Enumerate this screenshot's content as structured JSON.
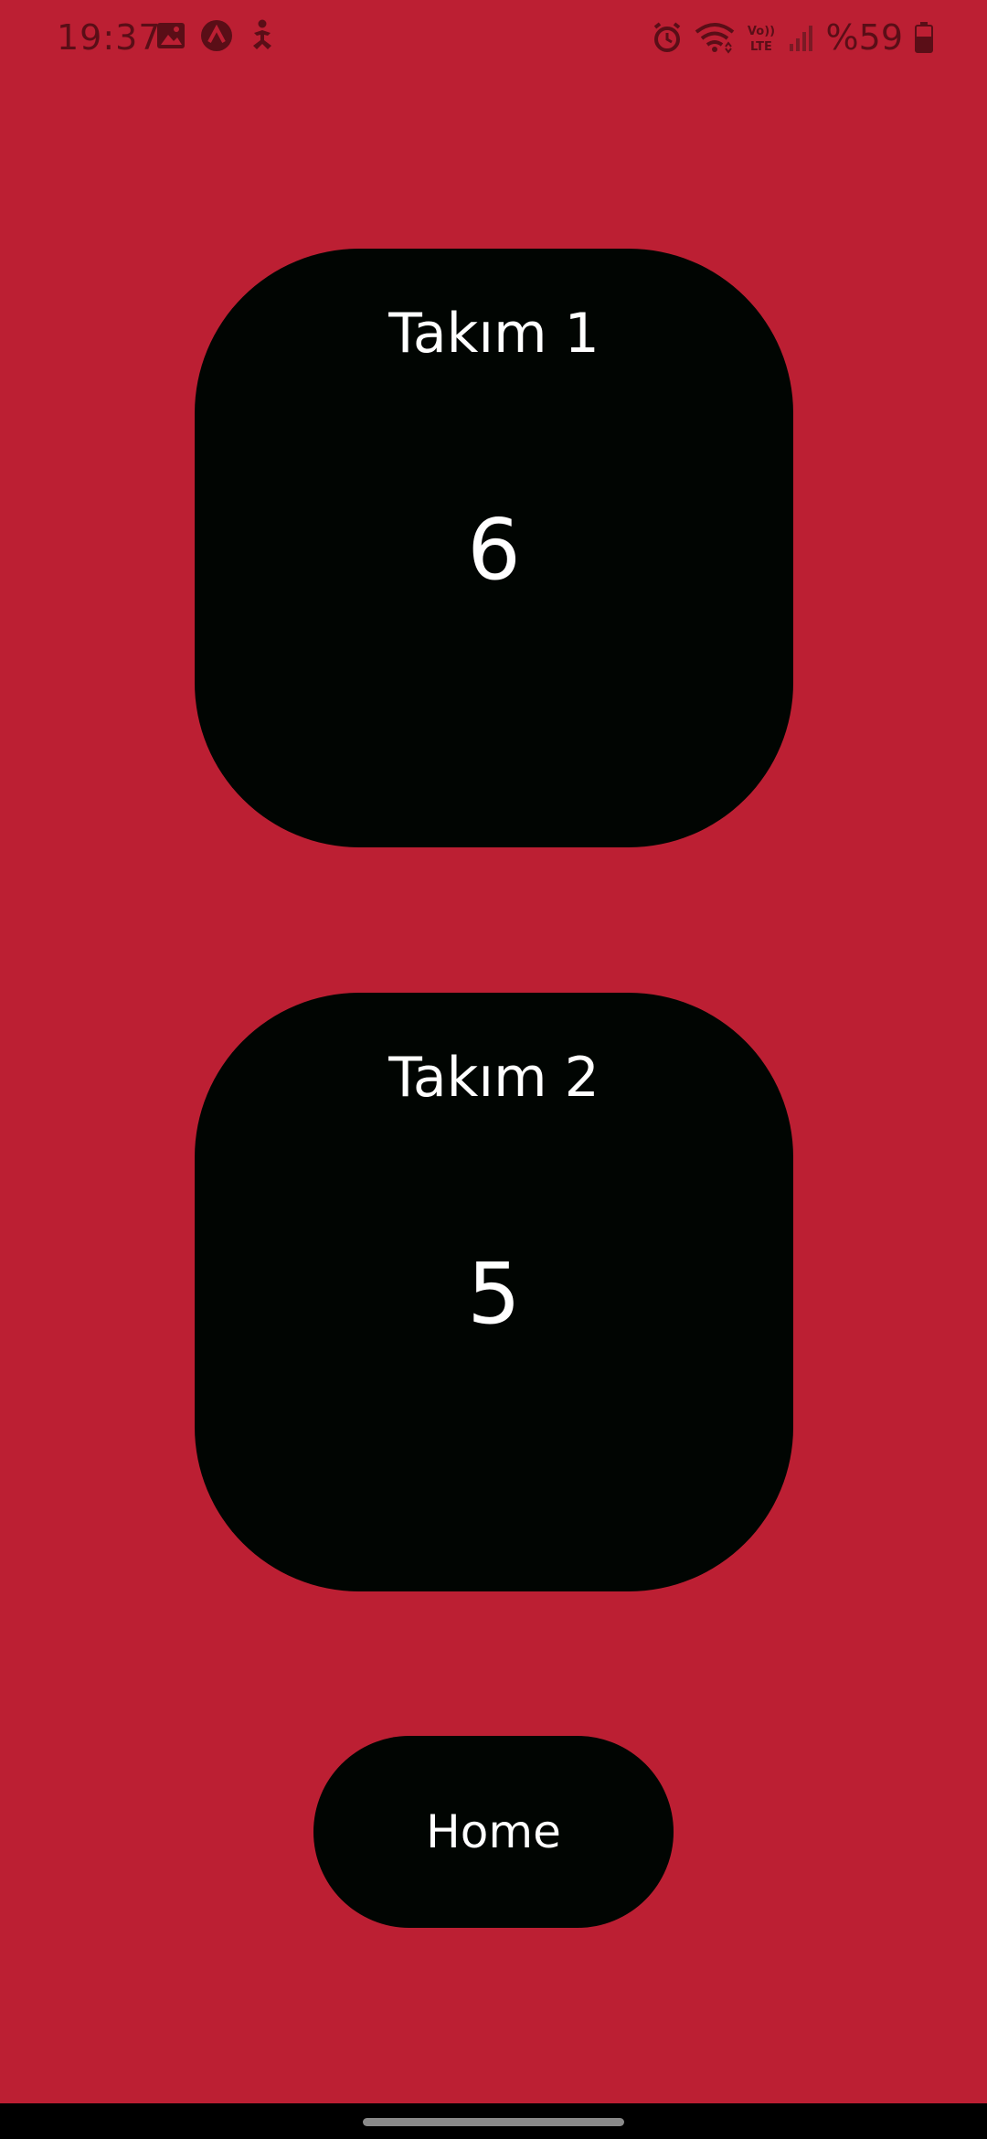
{
  "status_bar": {
    "time": "19:37",
    "battery_text": "%59",
    "icons_left": [
      "gallery-icon",
      "app-a-icon",
      "accessibility-icon"
    ],
    "icons_right": [
      "alarm-icon",
      "wifi-icon",
      "volte-icon",
      "signal-icon",
      "battery-icon"
    ]
  },
  "teams": [
    {
      "name": "Takım 1",
      "score": "6"
    },
    {
      "name": "Takım 2",
      "score": "5"
    }
  ],
  "home_button": {
    "label": "Home"
  },
  "colors": {
    "background": "#bc1f33",
    "card": "#010502",
    "text": "#ffffff"
  }
}
